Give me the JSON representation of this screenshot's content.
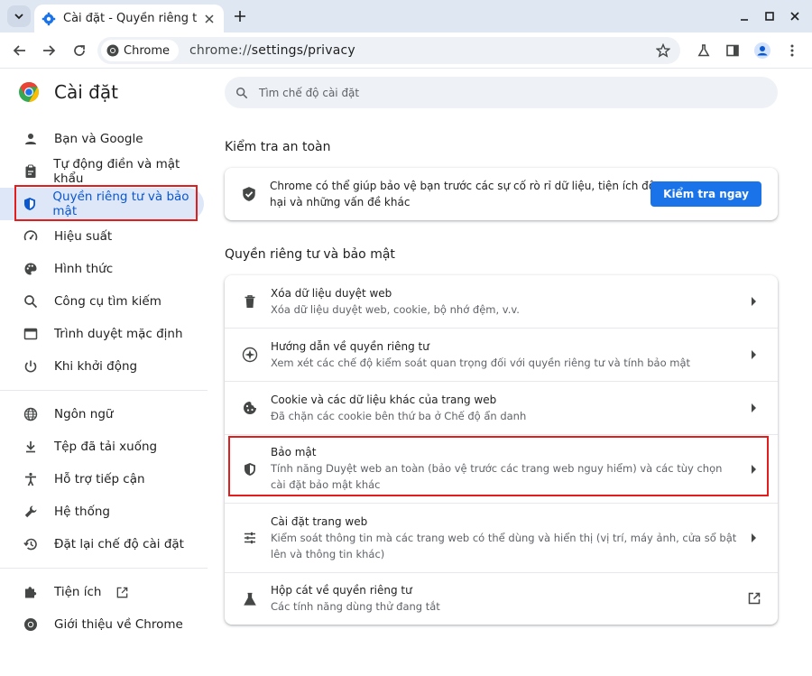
{
  "browser": {
    "tab_title": "Cài đặt - Quyền riêng tư v",
    "chip_label": "Chrome",
    "url_prefix": "chrome://",
    "url_path": "settings/privacy"
  },
  "sidebar": {
    "title": "Cài đặt",
    "items": [
      {
        "label": "Bạn và Google",
        "icon": "person-icon"
      },
      {
        "label": "Tự động điền và mật khẩu",
        "icon": "clipboard-icon"
      },
      {
        "label": "Quyền riêng tư và bảo mật",
        "icon": "shield-icon",
        "active": true
      },
      {
        "label": "Hiệu suất",
        "icon": "speedometer-icon"
      },
      {
        "label": "Hình thức",
        "icon": "palette-icon"
      },
      {
        "label": "Công cụ tìm kiếm",
        "icon": "search-icon"
      },
      {
        "label": "Trình duyệt mặc định",
        "icon": "browser-window-icon"
      },
      {
        "label": "Khi khởi động",
        "icon": "power-icon"
      }
    ],
    "items2": [
      {
        "label": "Ngôn ngữ",
        "icon": "globe-icon"
      },
      {
        "label": "Tệp đã tải xuống",
        "icon": "download-icon"
      },
      {
        "label": "Hỗ trợ tiếp cận",
        "icon": "accessibility-icon"
      },
      {
        "label": "Hệ thống",
        "icon": "wrench-icon"
      },
      {
        "label": "Đặt lại chế độ cài đặt",
        "icon": "reset-icon"
      }
    ],
    "items3": [
      {
        "label": "Tiện ích",
        "icon": "puzzle-icon"
      },
      {
        "label": "Giới thiệu về Chrome",
        "icon": "chrome-icon"
      }
    ]
  },
  "search": {
    "placeholder": "Tìm chế độ cài đặt"
  },
  "safety": {
    "section_title": "Kiểm tra an toàn",
    "text": "Chrome có thể giúp bảo vệ bạn trước các sự cố rò rỉ dữ liệu, tiện ích độc hại và những vấn đề khác",
    "button": "Kiểm tra ngay"
  },
  "privacy": {
    "section_title": "Quyền riêng tư và bảo mật",
    "rows": [
      {
        "title": "Xóa dữ liệu duyệt web",
        "desc": "Xóa dữ liệu duyệt web, cookie, bộ nhớ đệm, v.v."
      },
      {
        "title": "Hướng dẫn về quyền riêng tư",
        "desc": "Xem xét các chế độ kiểm soát quan trọng đối với quyền riêng tư và tính bảo mật"
      },
      {
        "title": "Cookie và các dữ liệu khác của trang web",
        "desc": "Đã chặn các cookie bên thứ ba ở Chế độ ẩn danh"
      },
      {
        "title": "Bảo mật",
        "desc": "Tính năng Duyệt web an toàn (bảo vệ trước các trang web nguy hiểm) và các tùy chọn cài đặt bảo mật khác"
      },
      {
        "title": "Cài đặt trang web",
        "desc": "Kiểm soát thông tin mà các trang web có thể dùng và hiển thị (vị trí, máy ảnh, cửa sổ bật lên và thông tin khác)"
      },
      {
        "title": "Hộp cát về quyền riêng tư",
        "desc": "Các tính năng dùng thử đang tắt"
      }
    ]
  },
  "colors": {
    "accent": "#0b57d0",
    "button": "#1a73e8",
    "highlight": "#e11d1d"
  }
}
